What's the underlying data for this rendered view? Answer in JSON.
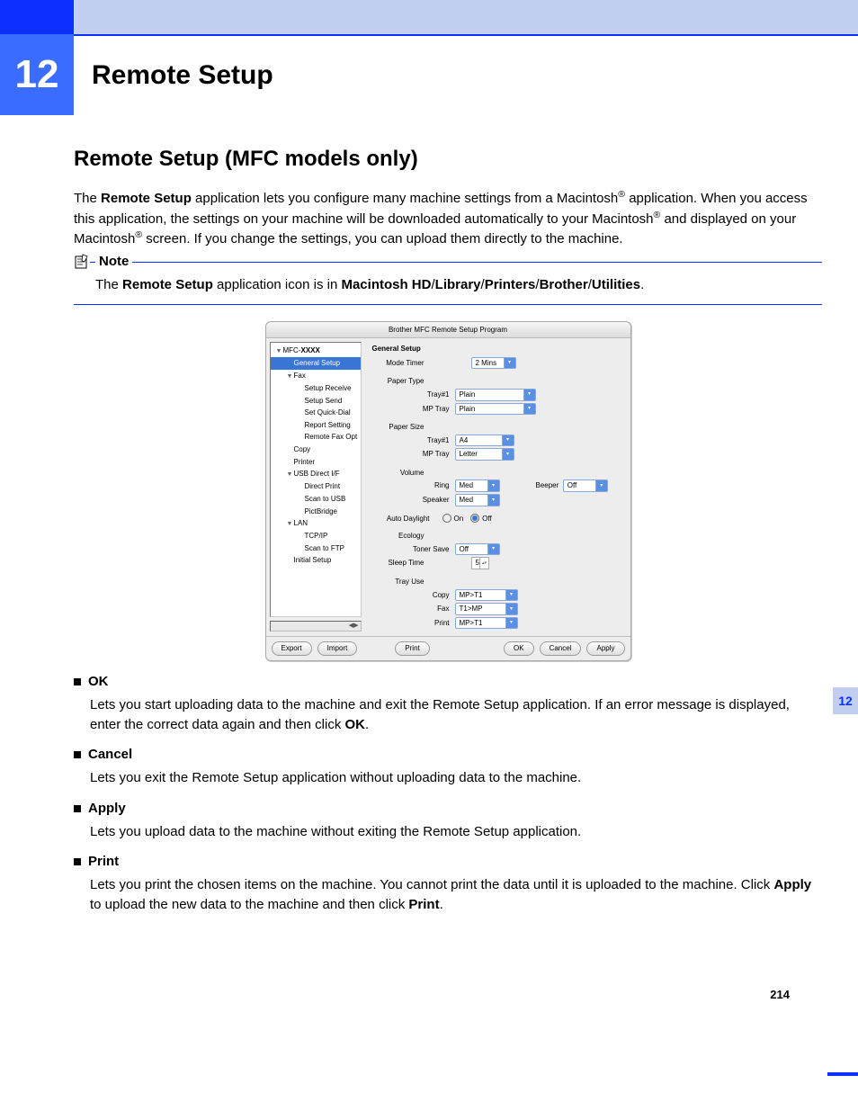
{
  "chapter": {
    "number": "12",
    "title": "Remote Setup"
  },
  "sideTab": "12",
  "pageNumber": "214",
  "section": {
    "heading": "Remote Setup (MFC models only)",
    "intro": {
      "p1a": "The ",
      "p1b_bold": "Remote Setup",
      "p1c": " application lets you configure many machine settings from a Macintosh",
      "p1d": " application. When you access this application, the settings on your machine will be downloaded automatically to your Macintosh",
      "p1e": " and displayed on your Macintosh",
      "p1f": " screen. If you change the settings, you can upload them directly to the machine."
    }
  },
  "note": {
    "label": "Note",
    "body": {
      "a": "The ",
      "b_bold": "Remote Setup",
      "c": " application icon is in ",
      "d_bold": "Macintosh HD",
      "e": "/",
      "f_bold": "Library",
      "g": "/",
      "h_bold": "Printers",
      "i": "/",
      "j_bold": "Brother",
      "k": "/",
      "l_bold": "Utilities",
      "m": "."
    }
  },
  "app": {
    "title": "Brother MFC Remote Setup Program",
    "tree": [
      {
        "label": "MFC-",
        "bold": "XXXX",
        "indent": 0,
        "tri": true
      },
      {
        "label": "General Setup",
        "indent": 1,
        "selected": true
      },
      {
        "label": "Fax",
        "indent": 1,
        "tri": true
      },
      {
        "label": "Setup Receive",
        "indent": 2
      },
      {
        "label": "Setup Send",
        "indent": 2
      },
      {
        "label": "Set Quick-Dial",
        "indent": 2
      },
      {
        "label": "Report Setting",
        "indent": 2
      },
      {
        "label": "Remote Fax Opt",
        "indent": 2
      },
      {
        "label": "Copy",
        "indent": 1
      },
      {
        "label": "Printer",
        "indent": 1
      },
      {
        "label": "USB Direct I/F",
        "indent": 1,
        "tri": true
      },
      {
        "label": "Direct Print",
        "indent": 2
      },
      {
        "label": "Scan to USB",
        "indent": 2
      },
      {
        "label": "PictBridge",
        "indent": 2
      },
      {
        "label": "LAN",
        "indent": 1,
        "tri": true
      },
      {
        "label": "TCP/IP",
        "indent": 2
      },
      {
        "label": "Scan to FTP",
        "indent": 2
      },
      {
        "label": "Initial Setup",
        "indent": 1
      }
    ],
    "panel": {
      "title": "General Setup",
      "modeTimer": {
        "label": "Mode Timer",
        "value": "2 Mins"
      },
      "paperType": {
        "label": "Paper Type",
        "tray1Label": "Tray#1",
        "tray1": "Plain",
        "mpLabel": "MP Tray",
        "mp": "Plain"
      },
      "paperSize": {
        "label": "Paper Size",
        "tray1Label": "Tray#1",
        "tray1": "A4",
        "mpLabel": "MP Tray",
        "mp": "Letter"
      },
      "volume": {
        "label": "Volume",
        "ringLabel": "Ring",
        "ring": "Med",
        "beeperLabel": "Beeper",
        "beeper": "Off",
        "speakerLabel": "Speaker",
        "speaker": "Med"
      },
      "autoDaylight": {
        "label": "Auto Daylight",
        "on": "On",
        "off": "Off"
      },
      "ecology": {
        "label": "Ecology",
        "tonerSaveLabel": "Toner Save",
        "tonerSave": "Off"
      },
      "sleepTime": {
        "label": "Sleep Time",
        "value": "5"
      },
      "trayUse": {
        "label": "Tray Use",
        "copyLabel": "Copy",
        "copy": "MP>T1",
        "faxLabel": "Fax",
        "fax": "T1>MP",
        "printLabel": "Print",
        "print": "MP>T1"
      }
    },
    "buttons": {
      "export": "Export",
      "import": "Import",
      "print": "Print",
      "ok": "OK",
      "cancel": "Cancel",
      "apply": "Apply"
    }
  },
  "definitions": {
    "ok": {
      "term": "OK",
      "a": "Lets you start uploading data to the machine and exit the Remote Setup application. If an error message is displayed, enter the correct data again and then click ",
      "b_bold": "OK",
      "c": "."
    },
    "cancel": {
      "term": "Cancel",
      "desc": "Lets you exit the Remote Setup application without uploading data to the machine."
    },
    "apply": {
      "term": "Apply",
      "desc": "Lets you upload data to the machine without exiting the Remote Setup application."
    },
    "print": {
      "term": "Print",
      "a": "Lets you print the chosen items on the machine. You cannot print the data until it is uploaded to the machine. Click ",
      "b_bold": "Apply",
      "c": " to upload the new data to the machine and then click ",
      "d_bold": "Print",
      "e": "."
    }
  }
}
